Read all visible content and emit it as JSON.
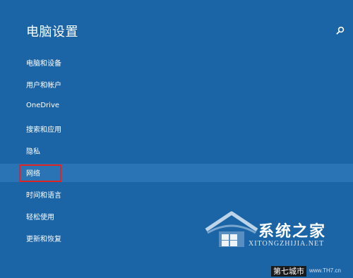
{
  "colors": {
    "background": "#1b64a6",
    "selected_item": "#2a74b5",
    "highlight_box": "#e02424",
    "text": "#ffffff"
  },
  "header": {
    "title": "电脑设置",
    "search_icon": "search-icon"
  },
  "nav": {
    "items": [
      {
        "label": "电脑和设备",
        "selected": false
      },
      {
        "label": "用户和帐户",
        "selected": false
      },
      {
        "label": "OneDrive",
        "selected": false
      },
      {
        "label": "搜索和应用",
        "selected": false
      },
      {
        "label": "隐私",
        "selected": false
      },
      {
        "label": "网络",
        "selected": true
      },
      {
        "label": "时间和语言",
        "selected": false
      },
      {
        "label": "轻松使用",
        "selected": false
      },
      {
        "label": "更新和恢复",
        "selected": false
      }
    ]
  },
  "watermark": {
    "site_name": "系统之家",
    "site_url": "XITONGZHIJIA.NET",
    "logo_icon": "house-logo-icon"
  },
  "footer": {
    "brand": "第七城市",
    "url": "www.TH7.cn"
  }
}
